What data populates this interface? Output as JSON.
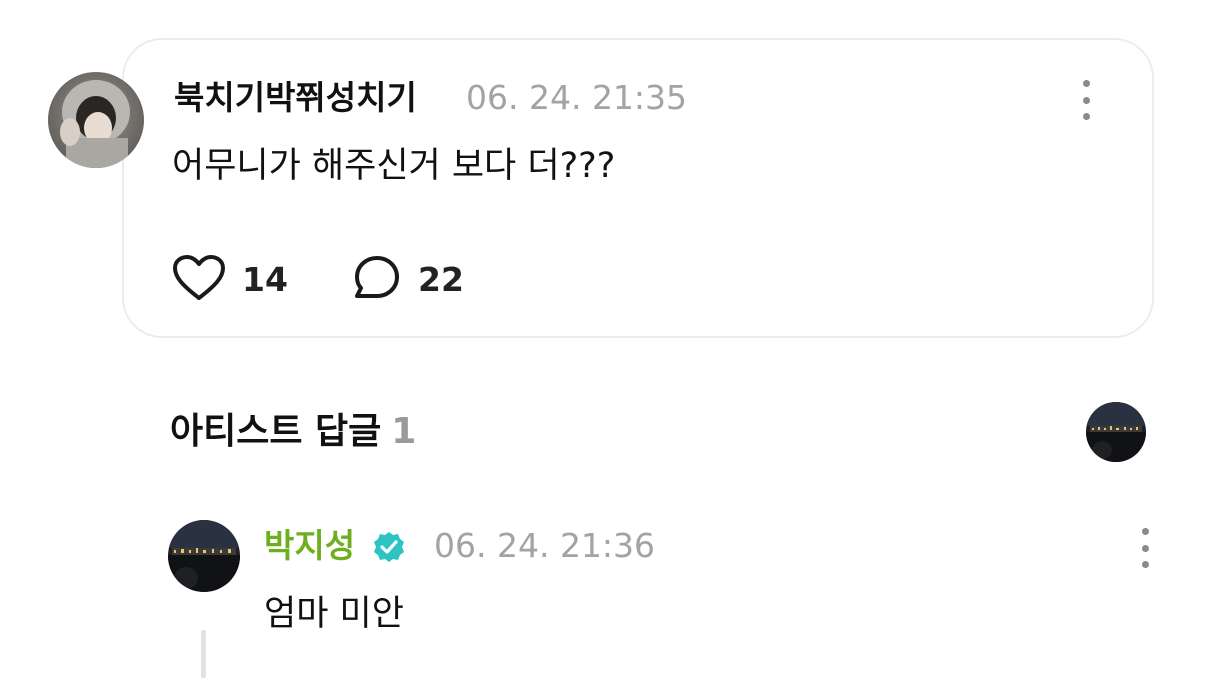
{
  "comment": {
    "author": "북치기박쮜성치기",
    "timestamp": "06. 24. 21:35",
    "text": "어무니가 해주신거 보다 더???",
    "likes": "14",
    "replies": "22",
    "icons": {
      "like": "heart-icon",
      "reply": "speech-bubble-icon",
      "more": "more-vertical-icon"
    }
  },
  "artist_replies": {
    "title": "아티스트 답글",
    "count": "1"
  },
  "reply": {
    "author": "박지성",
    "verified": true,
    "timestamp": "06. 24. 21:36",
    "text": "엄마 미안",
    "icons": {
      "verified": "verified-badge-icon",
      "more": "more-vertical-icon"
    }
  },
  "colors": {
    "artist_name": "#6fae1f",
    "verified_badge": "#2ec4c4",
    "timestamp": "#a3a3a3",
    "card_border": "#ececec"
  }
}
